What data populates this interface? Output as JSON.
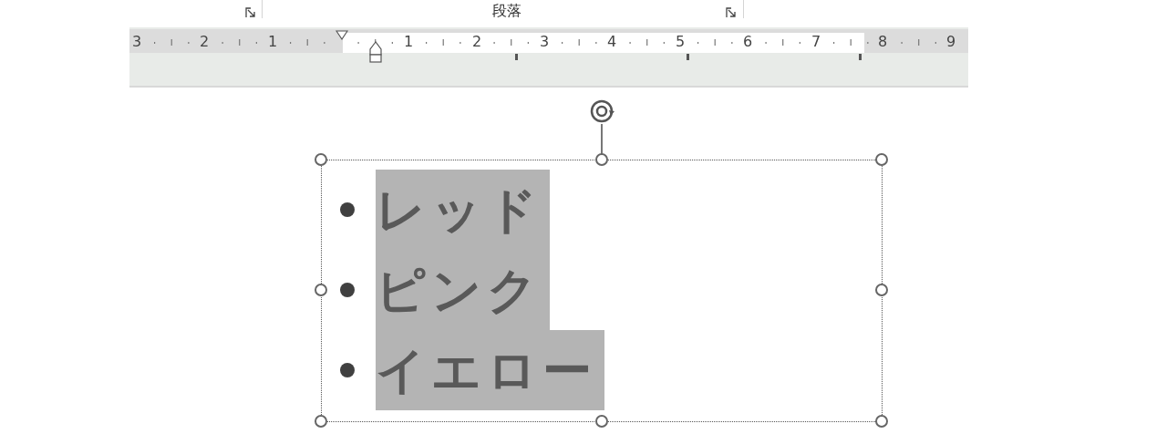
{
  "ribbon": {
    "group_label": "段落"
  },
  "ruler": {
    "labels": [
      "3",
      "2",
      "1",
      "1",
      "2",
      "3",
      "4",
      "5",
      "6",
      "7",
      "8",
      "9"
    ]
  },
  "text_box": {
    "items": [
      {
        "text": "レッド",
        "selected": true
      },
      {
        "text": "ピンク",
        "selected": true
      },
      {
        "text": "イエロー",
        "selected": true
      }
    ]
  }
}
